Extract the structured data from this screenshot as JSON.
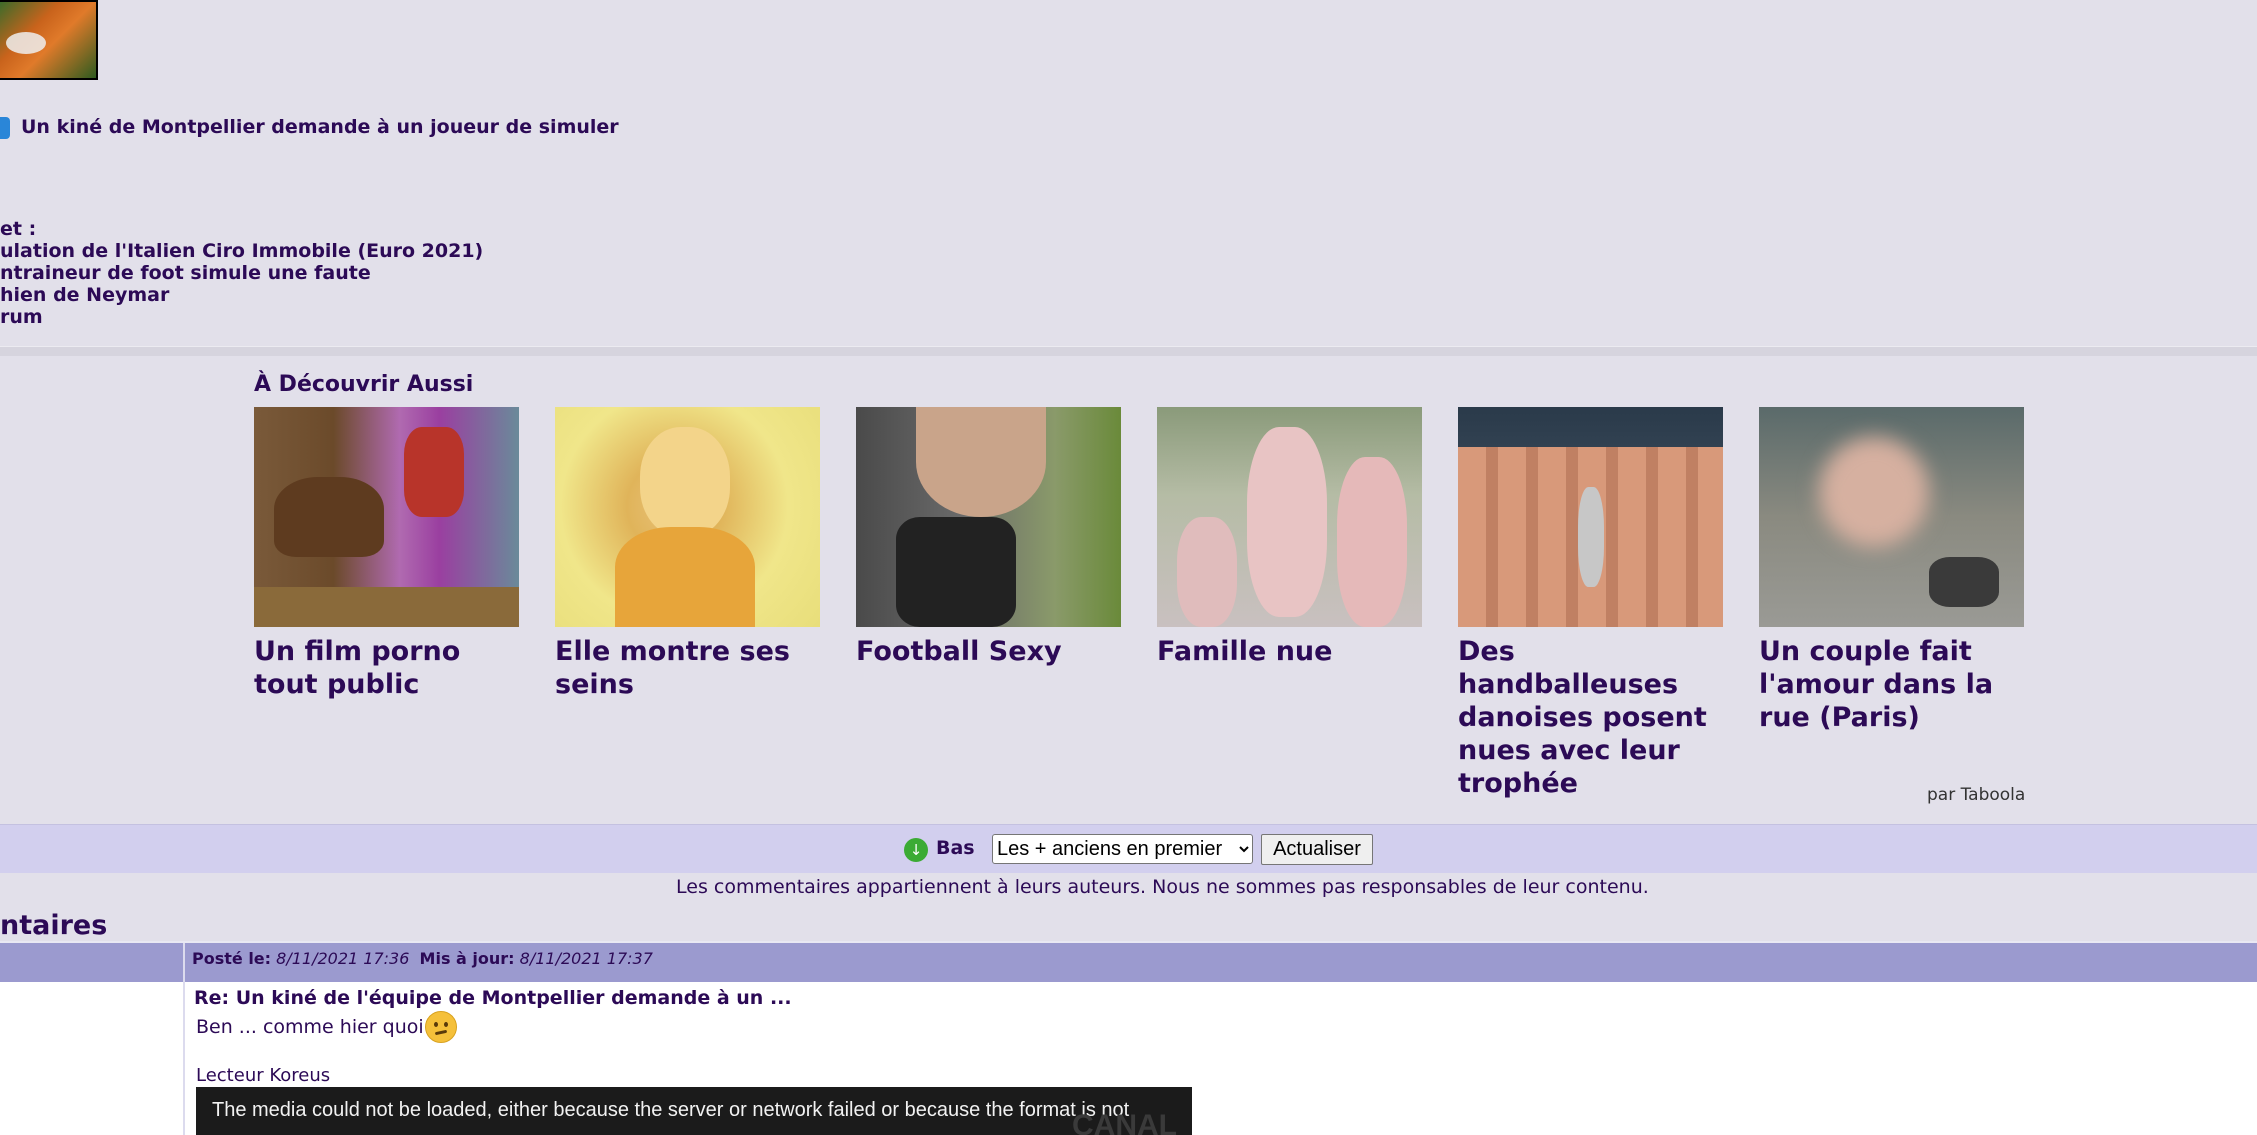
{
  "top_article": {
    "link": "Un kiné de Montpellier demande à un joueur de simuler"
  },
  "related": {
    "label": "et :",
    "items": [
      "ulation de l'Italien Ciro Immobile (Euro 2021)",
      "ntraineur de foot simule une faute",
      "hien de Neymar",
      "rum"
    ]
  },
  "discover": {
    "title": "À Découvrir Aussi",
    "cards": [
      {
        "title": "Un film porno tout public"
      },
      {
        "title": "Elle montre ses seins"
      },
      {
        "title": "Football Sexy"
      },
      {
        "title": "Famille nue"
      },
      {
        "title": "Des handballeuses danoises posent nues avec leur trophée"
      },
      {
        "title": "Un couple fait l'amour dans la rue (Paris)"
      }
    ],
    "attribution": "par Taboola"
  },
  "toolbar": {
    "down_label": "Bas",
    "sort_selected": "Les + anciens en premier",
    "refresh_label": "Actualiser"
  },
  "disclaimer": "Les commentaires appartiennent à leurs auteurs. Nous ne sommes pas responsables de leur contenu.",
  "comments": {
    "heading": "ntaires",
    "items": [
      {
        "posted_label": "Posté le:",
        "posted_date": "8/11/2021 17:36",
        "updated_label": "Mis à jour:",
        "updated_date": "8/11/2021 17:37",
        "title": "Re: Un kiné de l'équipe de Montpellier demande à un ...",
        "body": "Ben ... comme hier quoi",
        "author": "Lecteur Koreus",
        "media_error": "The media could not be loaded, either because the server or network failed or because the format is not",
        "media_watermark": "CANAL"
      }
    ]
  },
  "colors": {
    "background": "#e2e0ea",
    "link": "#2c0a56",
    "toolbar": "#d2cfee",
    "comment_header": "#9b9acf"
  }
}
